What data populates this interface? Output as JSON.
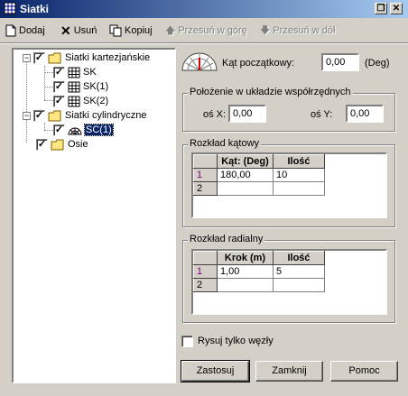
{
  "window": {
    "title": "Siatki"
  },
  "toolbar": {
    "add_label": "Dodaj",
    "delete_label": "Usuń",
    "copy_label": "Kopiuj",
    "move_up_label": "Przesuń w górę",
    "move_down_label": "Przesuń w dół"
  },
  "tree": {
    "cartesian_label": "Siatki kartezjańskie",
    "cartesian_items": [
      "SK",
      "SK(1)",
      "SK(2)"
    ],
    "cylindrical_label": "Siatki cylindryczne",
    "cylindrical_items": [
      "SC(1)"
    ],
    "axes_label": "Osie"
  },
  "start_angle": {
    "label": "Kąt początkowy:",
    "value": "0,00",
    "unit": "(Deg)"
  },
  "position": {
    "legend": "Położenie w układzie współrzędnych",
    "x_label": "oś X:",
    "x_value": "0,00",
    "y_label": "oś Y:",
    "y_value": "0,00"
  },
  "angular": {
    "legend": "Rozkład kątowy",
    "headers": [
      "Kąt: (Deg)",
      "Ilość"
    ],
    "rows": [
      {
        "num": "1",
        "c1": "180,00",
        "c2": "10"
      },
      {
        "num": "2",
        "c1": "",
        "c2": ""
      }
    ]
  },
  "radial": {
    "legend": "Rozkład radialny",
    "headers": [
      "Krok (m)",
      "Ilość"
    ],
    "rows": [
      {
        "num": "1",
        "c1": "1,00",
        "c2": "5"
      },
      {
        "num": "2",
        "c1": "",
        "c2": ""
      }
    ]
  },
  "nodes_only": {
    "label": "Rysuj tylko węzły"
  },
  "buttons": {
    "apply": "Zastosuj",
    "close": "Zamknij",
    "help": "Pomoc"
  }
}
